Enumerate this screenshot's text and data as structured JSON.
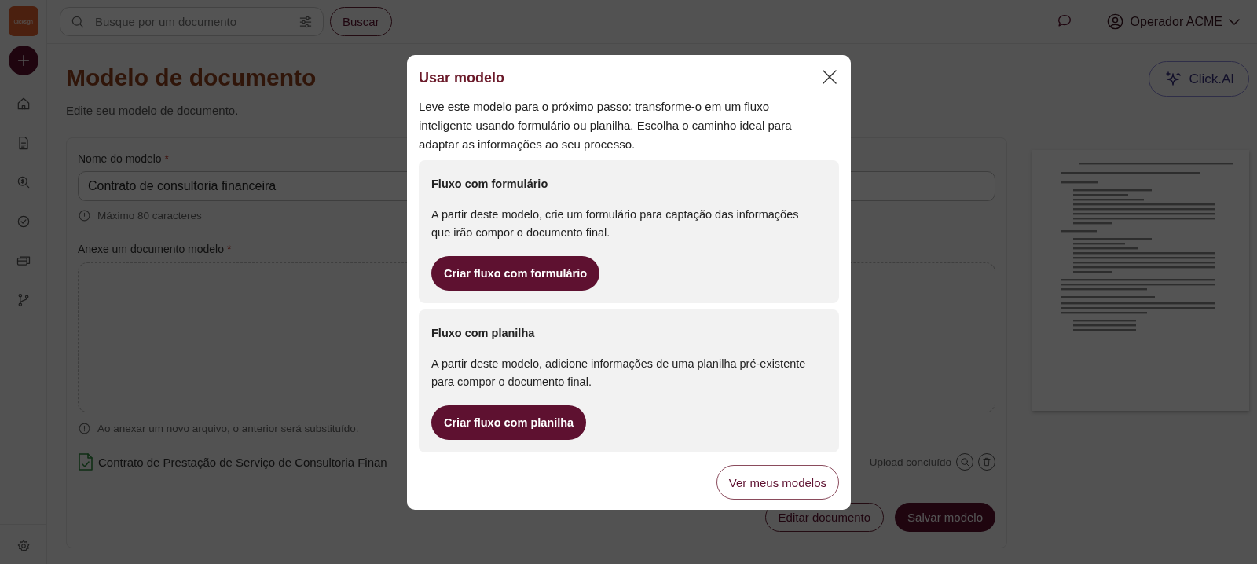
{
  "sidebar": {
    "logo": "Clicksign"
  },
  "search": {
    "placeholder": "Busque por um documento",
    "button": "Buscar"
  },
  "user": {
    "name": "Operador ACME"
  },
  "page": {
    "title": "Modelo de documento",
    "subtitle": "Edite seu modelo de documento.",
    "ai_button": "Click.AI"
  },
  "form": {
    "name_field": {
      "label": "Nome do modelo",
      "required_mark": "*",
      "value": "Contrato de consultoria financeira",
      "hint": "Máximo 80 caracteres"
    },
    "attach_field": {
      "label": "Anexe um documento modelo",
      "required_mark": "*",
      "hint": "Ao anexar um novo arquivo, o anterior será substituído."
    },
    "file": {
      "name": "Contrato de Prestação de Serviço de Consultoria Finan",
      "status": "Upload concluído"
    },
    "buttons": [
      {
        "label": "Editar documento",
        "kind": "outline"
      },
      {
        "label": "Salvar modelo",
        "kind": "primary"
      }
    ]
  },
  "modal": {
    "title": "Usar modelo",
    "text": "Leve este modelo para o próximo passo: transforme-o em um fluxo inteligente usando formulário ou planilha. Escolha o caminho ideal para adaptar as informações ao seu processo.",
    "options": [
      {
        "title": "Fluxo com formulário",
        "text": "A partir deste modelo, crie um formulário para captação das informações que irão compor o documento final.",
        "button": "Criar fluxo com formulário"
      },
      {
        "title": "Fluxo com planilha",
        "text": "A partir deste modelo, adicione informações de uma planilha pré-existente para compor o documento final.",
        "button": "Criar fluxo com planilha"
      }
    ],
    "footer_button": "Ver meus modelos"
  }
}
